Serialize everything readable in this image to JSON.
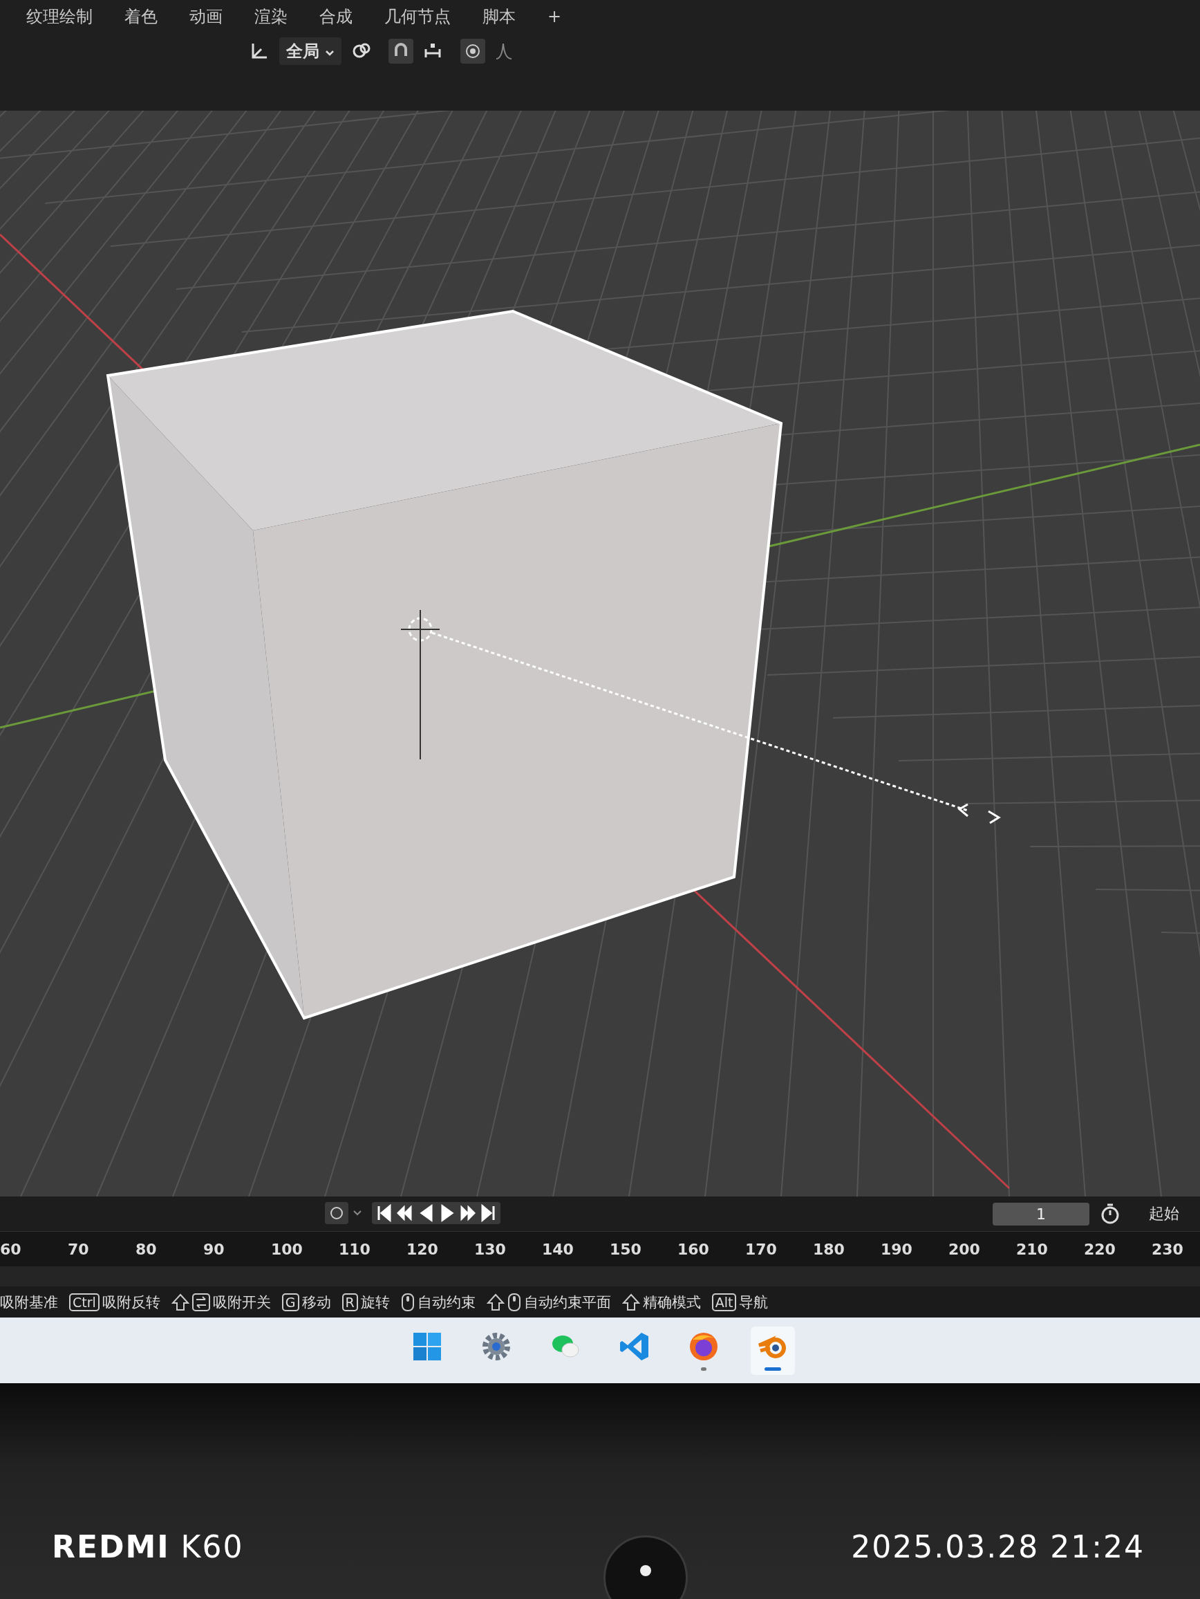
{
  "workspace_tabs": [
    {
      "label": "纹理绘制"
    },
    {
      "label": "着色"
    },
    {
      "label": "动画"
    },
    {
      "label": "渲染"
    },
    {
      "label": "合成"
    },
    {
      "label": "几何节点"
    },
    {
      "label": "脚本"
    },
    {
      "label": "+"
    }
  ],
  "toolbar": {
    "transform_orientation": "全局"
  },
  "timeline": {
    "current_frame": "1",
    "start_label": "起始",
    "ruler": [
      "60",
      "70",
      "80",
      "90",
      "100",
      "110",
      "120",
      "130",
      "140",
      "150",
      "160",
      "170",
      "180",
      "190",
      "200",
      "210",
      "220",
      "230"
    ]
  },
  "status_bar": [
    {
      "label": "吸附基准"
    },
    {
      "key": "Ctrl",
      "label": "吸附反转"
    },
    {
      "shift": true,
      "snap": true,
      "label": "吸附开关"
    },
    {
      "key": "G",
      "label": "移动"
    },
    {
      "key": "R",
      "label": "旋转"
    },
    {
      "mouse": true,
      "label": "自动约束"
    },
    {
      "shift": true,
      "mouse": true,
      "label": "自动约束平面"
    },
    {
      "shift": true,
      "label": "精确模式"
    },
    {
      "key": "Alt",
      "label": "导航"
    }
  ],
  "taskbar": [
    {
      "kind": "start",
      "open": false,
      "focused": false
    },
    {
      "kind": "settings",
      "open": false,
      "focused": false
    },
    {
      "kind": "chat",
      "open": false,
      "focused": false
    },
    {
      "kind": "editor",
      "open": false,
      "focused": false
    },
    {
      "kind": "browser",
      "open": true,
      "focused": false
    },
    {
      "kind": "blender",
      "open": true,
      "focused": true
    }
  ],
  "camera_watermark": {
    "device": "**REDMI** K60",
    "timestamp": "2025.03.28 21:24"
  }
}
